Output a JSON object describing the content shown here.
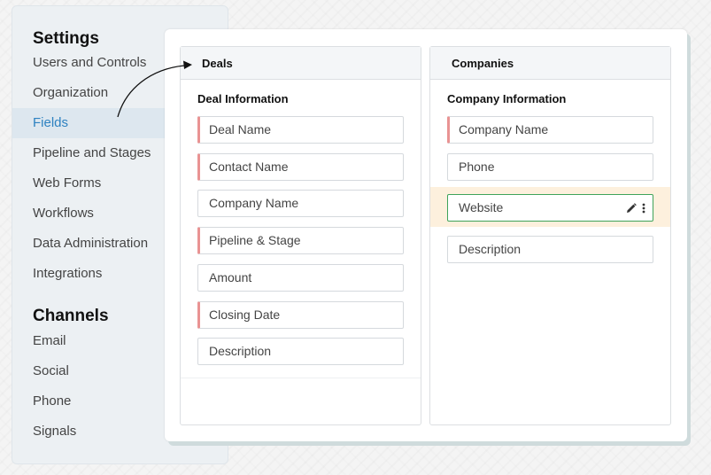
{
  "sidebar": {
    "settings_title": "Settings",
    "settings_items": [
      {
        "label": "Users and Controls"
      },
      {
        "label": "Organization"
      },
      {
        "label": "Fields",
        "active": true
      },
      {
        "label": "Pipeline and Stages"
      },
      {
        "label": "Web Forms"
      },
      {
        "label": "Workflows"
      },
      {
        "label": "Data Administration"
      },
      {
        "label": "Integrations"
      }
    ],
    "channels_title": "Channels",
    "channels_items": [
      {
        "label": "Email"
      },
      {
        "label": "Social"
      },
      {
        "label": "Phone"
      },
      {
        "label": "Signals"
      }
    ]
  },
  "deals": {
    "title": "Deals",
    "section": "Deal Information",
    "fields": [
      {
        "label": "Deal Name",
        "required": true
      },
      {
        "label": "Contact Name",
        "required": true
      },
      {
        "label": "Company Name",
        "required": false
      },
      {
        "label": "Pipeline & Stage",
        "required": true
      },
      {
        "label": "Amount",
        "required": false
      },
      {
        "label": "Closing Date",
        "required": true
      },
      {
        "label": "Description",
        "required": false
      }
    ]
  },
  "companies": {
    "title": "Companies",
    "section": "Company Information",
    "fields": [
      {
        "label": "Company Name",
        "required": true
      },
      {
        "label": "Phone",
        "required": false
      },
      {
        "label": "Website",
        "required": false,
        "selected": true
      },
      {
        "label": "Description",
        "required": false
      }
    ]
  },
  "colors": {
    "accent": "#2e82c1",
    "required_marker": "#e99393",
    "selected_border": "#3fa35a",
    "selected_highlight": "#fdf0dd"
  },
  "icons": [
    "pencil-icon",
    "more-vertical-icon",
    "curved-arrow-icon"
  ]
}
